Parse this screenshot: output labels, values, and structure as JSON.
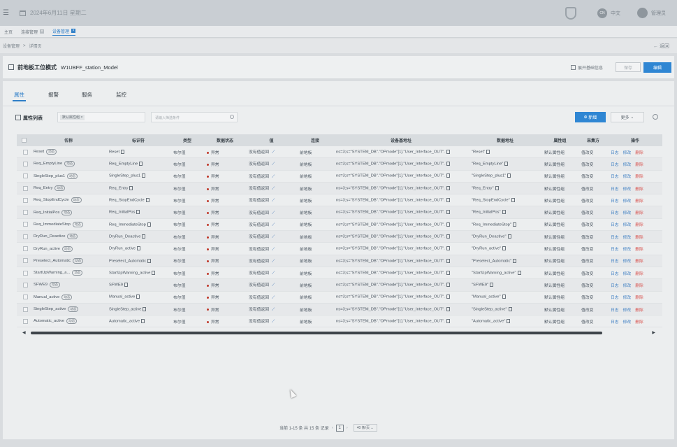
{
  "header": {
    "date": "2024年6月11日 星期二",
    "lang_badge": "CN",
    "lang": "中文",
    "user": "管理员"
  },
  "page_tabs": [
    {
      "label": "主页",
      "active": false
    },
    {
      "label": "连接管理",
      "active": false
    },
    {
      "label": "设备管理",
      "active": true
    }
  ],
  "breadcrumb": [
    "设备管理",
    ">",
    "详情页"
  ],
  "back_label": "← 返回",
  "title": {
    "category": "前地板工位模式",
    "model": "W1UBFF_station_Model",
    "expand_label": "展开基础信息",
    "save_label": "保存",
    "edit_label": "编辑"
  },
  "sub_tabs": [
    {
      "label": "属性",
      "active": true
    },
    {
      "label": "报警",
      "active": false
    },
    {
      "label": "服务",
      "active": false
    },
    {
      "label": "监控",
      "active": false
    }
  ],
  "list": {
    "title": "属性列表",
    "filter_tag": "默认属性组",
    "search_placeholder": "请输入筛选条件",
    "new_label": "新增",
    "more_label": "更多"
  },
  "columns": [
    "名称",
    "标识符",
    "类型",
    "数据状态",
    "值",
    "连接",
    "设备基地址",
    "数据地址",
    "属性组",
    "采集方",
    "操作"
  ],
  "rows": [
    {
      "name": "Reset",
      "ident": "Reset",
      "addr": "ns=3;s=\"SYSTEM_DB\".\"OPmode\"[1].\"User_Interface_OUT\".",
      "daddr": "\"Reset\""
    },
    {
      "name": "Req_EmptyLine",
      "ident": "Req_EmptyLine",
      "addr": "ns=3;s=\"SYSTEM_DB\".\"OPmode\"[1].\"User_Interface_OUT\".",
      "daddr": "\"Req_EmptyLine\""
    },
    {
      "name": "SingleStep_plus1",
      "ident": "SingleStep_plus1",
      "addr": "ns=3;s=\"SYSTEM_DB\".\"OPmode\"[1].\"User_Interface_OUT\".",
      "daddr": "\"SingleStep_plus1\""
    },
    {
      "name": "Req_Entry",
      "ident": "Req_Entry",
      "addr": "ns=3;s=\"SYSTEM_DB\".\"OPmode\"[1].\"User_Interface_OUT\".",
      "daddr": "\"Req_Entry\""
    },
    {
      "name": "Req_StopEndCycle",
      "ident": "Req_StopEndCycle",
      "addr": "ns=3;s=\"SYSTEM_DB\".\"OPmode\"[1].\"User_Interface_OUT\".",
      "daddr": "\"Req_StopEndCycle\""
    },
    {
      "name": "Req_InitialPos",
      "ident": "Req_InitialPos",
      "addr": "ns=3;s=\"SYSTEM_DB\".\"OPmode\"[1].\"User_Interface_OUT\".",
      "daddr": "\"Req_InitialPos\""
    },
    {
      "name": "Req_ImmediateStop",
      "ident": "Req_ImmediateStop",
      "addr": "ns=3;s=\"SYSTEM_DB\".\"OPmode\"[1].\"User_Interface_OUT\".",
      "daddr": "\"Req_ImmediateStop\""
    },
    {
      "name": "DryRun_Deactive",
      "ident": "DryRun_Deactive",
      "addr": "ns=3;s=\"SYSTEM_DB\".\"OPmode\"[1].\"User_Interface_OUT\".",
      "daddr": "\"DryRun_Deactive\""
    },
    {
      "name": "DryRun_active",
      "ident": "DryRun_active",
      "addr": "ns=3;s=\"SYSTEM_DB\".\"OPmode\"[1].\"User_Interface_OUT\".",
      "daddr": "\"DryRun_active\""
    },
    {
      "name": "Preselect_Automatic",
      "ident": "Preselect_Automatic",
      "addr": "ns=3;s=\"SYSTEM_DB\".\"OPmode\"[1].\"User_Interface_OUT\".",
      "daddr": "\"Preselect_Automatic\""
    },
    {
      "name": "StartUpWarning_a...",
      "ident": "StartUpWarning_active",
      "addr": "ns=3;s=\"SYSTEM_DB\".\"OPmode\"[1].\"User_Interface_OUT\".",
      "daddr": "\"StartUpWarning_active\""
    },
    {
      "name": "SFWE9",
      "ident": "SFWE9",
      "addr": "ns=3;s=\"SYSTEM_DB\".\"OPmode\"[1].\"User_Interface_OUT\".",
      "daddr": "\"SFWE9\""
    },
    {
      "name": "Manual_active",
      "ident": "Manual_active",
      "addr": "ns=3;s=\"SYSTEM_DB\".\"OPmode\"[1].\"User_Interface_OUT\".",
      "daddr": "\"Manual_active\""
    },
    {
      "name": "SingleStep_active",
      "ident": "SingleStep_active",
      "addr": "ns=3;s=\"SYSTEM_DB\".\"OPmode\"[1].\"User_Interface_OUT\".",
      "daddr": "\"SingleStep_active\""
    },
    {
      "name": "Automatic_active",
      "ident": "Automatic_active",
      "addr": "ns=3;s=\"SYSTEM_DB\".\"OPmode\"[1].\"User_Interface_OUT\".",
      "daddr": "\"Automatic_active\""
    }
  ],
  "row_common": {
    "badge": "动态",
    "type": "布尔值",
    "status": "异常",
    "value": "没有值返回",
    "conn": "前地板",
    "group": "默认属性组",
    "collector": "值改变",
    "op_log": "日志",
    "op_edit": "修改",
    "op_delete": "删除"
  },
  "pagination": {
    "summary": "当前 1-15 条 共 15 条 记录",
    "page": "1",
    "page_size": "40 条/页"
  },
  "colors": {
    "accent": "#2f86d3",
    "status_error": "#c0392b"
  }
}
